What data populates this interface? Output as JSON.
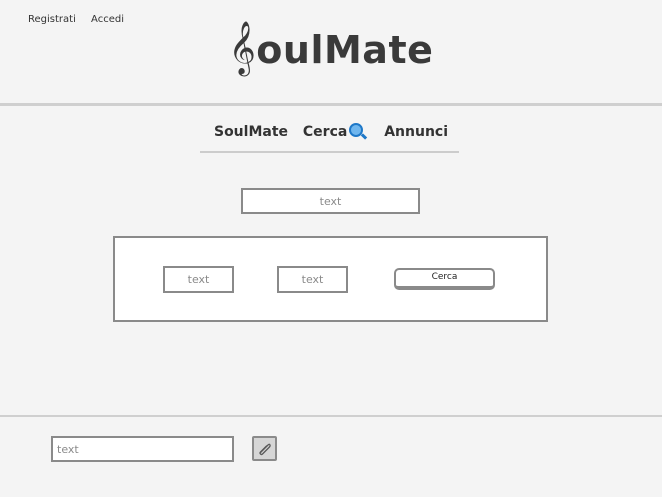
{
  "header": {
    "links": [
      "Registrati",
      "Accedi"
    ],
    "logo": {
      "clef": "𝄞",
      "text": "oulMate"
    }
  },
  "nav": {
    "items": [
      "SoulMate",
      "Cerca",
      "Annunci"
    ],
    "search_icon": "magnifier-icon"
  },
  "main": {
    "input_placeholder": "text",
    "filters": [
      {
        "placeholder": "text"
      },
      {
        "placeholder": "text"
      }
    ],
    "search_button": "Cerca"
  },
  "footer": {
    "input_placeholder": "text",
    "attach_icon": "paperclip-icon"
  },
  "colors": {
    "background": "#f4f4f4",
    "border": "#8a8a8a",
    "divider": "#cfcfcf",
    "accent": "#1e78c8"
  }
}
